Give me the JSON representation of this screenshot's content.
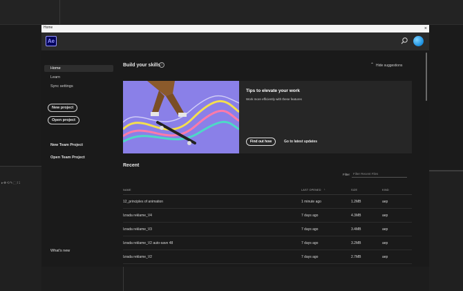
{
  "window": {
    "title": "Home",
    "close_symbol": "×"
  },
  "appbar": {
    "logo_text": "Ae"
  },
  "sidebar": {
    "items": [
      {
        "label": "Home",
        "active": true
      },
      {
        "label": "Learn",
        "active": false
      },
      {
        "label": "Sync settings",
        "active": false
      }
    ],
    "new_project": "New project",
    "open_project": "Open project",
    "new_team_project": "New Team Project",
    "open_team_project": "Open Team Project",
    "whats_new": "What's new"
  },
  "main": {
    "build_title": "Build your skills",
    "info_symbol": "i",
    "hide_suggestions": "Hide suggestions",
    "card": {
      "title": "Tips to elevate your work",
      "subtitle": "Work more efficiently with these features",
      "find_out_how": "Find out how",
      "latest_updates": "Go to latest updates"
    },
    "recent": {
      "title": "Recent",
      "filter_label": "Filter",
      "filter_placeholder": "Filter Recent Files",
      "columns": {
        "name": "NAME",
        "last_opened": "LAST OPENED",
        "size": "SIZE",
        "kind": "KIND"
      },
      "rows": [
        {
          "name": "12_principles of animation",
          "opened": "1 minute ago",
          "size": "1.2MB",
          "kind": "aep"
        },
        {
          "name": "Izrada reklame_V4",
          "opened": "7 days ago",
          "size": "4.3MB",
          "kind": "aep"
        },
        {
          "name": "Izrada reklame_V3",
          "opened": "7 days ago",
          "size": "3.4MB",
          "kind": "aep"
        },
        {
          "name": "Izrada reklame_V2 auto-save 48",
          "opened": "7 days ago",
          "size": "3.2MB",
          "kind": "aep"
        },
        {
          "name": "Izrada reklame_V2",
          "opened": "7 days ago",
          "size": "2.7MB",
          "kind": "aep"
        }
      ]
    }
  },
  "background": {
    "tools_glyphs": "▸✥⟲✎⬚⌇⟟"
  },
  "colors": {
    "accent_ae": "#9999ff",
    "hero_bg": "#8a80e8",
    "dialog_bg": "#1a1a1a"
  }
}
